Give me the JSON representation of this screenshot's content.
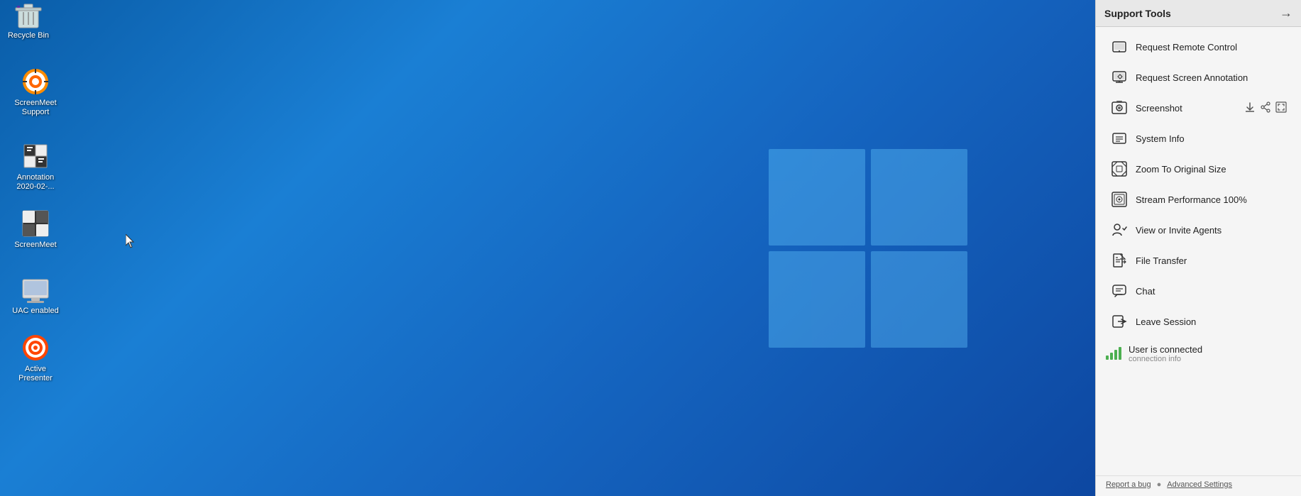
{
  "desktop": {
    "icons": [
      {
        "id": "recycle-bin",
        "label": "Recycle Bin",
        "symbol": "🗑️"
      },
      {
        "id": "screenmeet-support",
        "label": "ScreenMeet\nSupport",
        "symbol": "⚙️"
      },
      {
        "id": "annotation",
        "label": "Annotation\n2020-02-...",
        "symbol": "📝"
      },
      {
        "id": "screenmeet",
        "label": "ScreenMeet",
        "symbol": "🔲"
      },
      {
        "id": "uac-enabled",
        "label": "UAC enabled",
        "symbol": "🖥️"
      },
      {
        "id": "active-presenter",
        "label": "Active\nPresenter",
        "symbol": "🔴"
      }
    ]
  },
  "support_panel": {
    "title": "Support Tools",
    "items": [
      {
        "id": "request-remote-control",
        "label": "Request Remote Control",
        "icon": "remote"
      },
      {
        "id": "request-screen-annotation",
        "label": "Request Screen Annotation",
        "icon": "annotation"
      },
      {
        "id": "screenshot",
        "label": "Screenshot",
        "icon": "screenshot"
      },
      {
        "id": "system-info",
        "label": "System Info",
        "icon": "info"
      },
      {
        "id": "zoom-to-original",
        "label": "Zoom To Original Size",
        "icon": "zoom"
      },
      {
        "id": "stream-performance",
        "label": "Stream Performance 100%",
        "icon": "stream"
      },
      {
        "id": "view-invite-agents",
        "label": "View or Invite Agents",
        "icon": "agents"
      },
      {
        "id": "file-transfer",
        "label": "File Transfer",
        "icon": "transfer"
      },
      {
        "id": "chat",
        "label": "Chat",
        "icon": "chat"
      },
      {
        "id": "leave-session",
        "label": "Leave Session",
        "icon": "leave"
      }
    ],
    "connection": {
      "status_main": "User is connected",
      "status_sub": "connection info"
    },
    "footer": {
      "report_bug": "Report a bug",
      "dot": "●",
      "advanced_settings": "Advanced Settings"
    }
  }
}
